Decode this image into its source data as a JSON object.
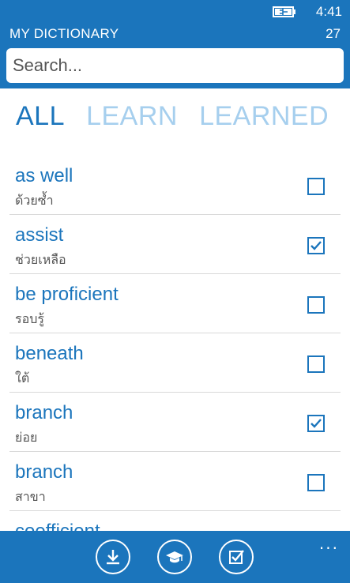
{
  "status": {
    "time": "4:41",
    "battery_icon": "battery-charging-icon"
  },
  "header": {
    "title": "MY DICTIONARY",
    "count": "27"
  },
  "search": {
    "placeholder": "Search...",
    "value": ""
  },
  "tabs": [
    {
      "label": "ALL",
      "active": true
    },
    {
      "label": "LEARN",
      "active": false
    },
    {
      "label": "LEARNED",
      "active": false
    }
  ],
  "words": [
    {
      "word": "as well",
      "meaning": "ด้วยซ้ำ",
      "checked": false
    },
    {
      "word": "assist",
      "meaning": "ช่วยเหลือ",
      "checked": true
    },
    {
      "word": "be proficient",
      "meaning": "รอบรู้",
      "checked": false
    },
    {
      "word": "beneath",
      "meaning": "ใต้",
      "checked": false
    },
    {
      "word": "branch",
      "meaning": "ย่อย",
      "checked": true
    },
    {
      "word": "branch",
      "meaning": "สาขา",
      "checked": false
    },
    {
      "word": "coefficient",
      "meaning": "",
      "checked": false
    }
  ],
  "appbar": {
    "buttons": [
      "download-icon",
      "graduation-cap-icon",
      "checklist-icon"
    ],
    "more": "..."
  },
  "colors": {
    "accent": "#1b75bc",
    "inactive_tab": "#a6cfee"
  }
}
